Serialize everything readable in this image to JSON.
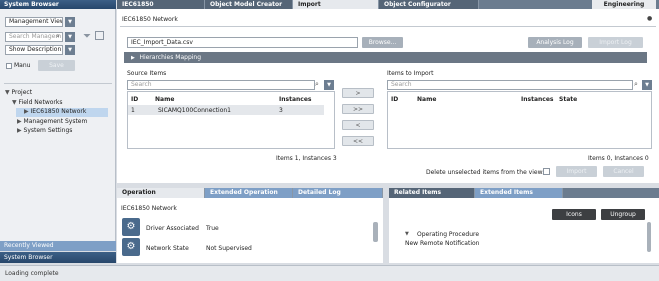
{
  "left_panel": {
    "title": "System Browser",
    "view_select": "Management View",
    "search_placeholder": "Search Managem",
    "description_select": "Show Description",
    "manual_label": "Manu",
    "save_label": "Save",
    "tree": [
      {
        "label": "Project"
      },
      {
        "label": "Field Networks"
      },
      {
        "label": "IEC61850 Network"
      },
      {
        "label": "Management System"
      },
      {
        "label": "System Settings"
      }
    ],
    "recently_viewed": "Recently Viewed",
    "footer_title": "System Browser"
  },
  "top_tabs": [
    {
      "label": "IEC61850"
    },
    {
      "label": "Object Model Creator"
    },
    {
      "label": "Import"
    },
    {
      "label": "Object Configurator"
    }
  ],
  "mode_label": "Engineering",
  "main": {
    "header": "IEC61850 Network",
    "file_value": "IEC_Import_Data.csv",
    "browse_label": "Browse...",
    "analysis_log_label": "Analysis Log",
    "import_log_label": "Import Log",
    "hierarchies_label": "Hierarchies Mapping",
    "source": {
      "title": "Source Items",
      "search_placeholder": "Search",
      "columns": [
        "ID",
        "Name",
        "Instances"
      ],
      "rows": [
        {
          "id": "1",
          "name": "SICAMQ100Connection1",
          "instances": "3"
        }
      ],
      "footer": "Items 1, Instances 3"
    },
    "transfer_buttons": [
      ">",
      ">>",
      "<",
      "<<"
    ],
    "target": {
      "title": "Items to Import",
      "search_placeholder": "Search",
      "columns": [
        "ID",
        "Name",
        "Instances",
        "State"
      ],
      "footer": "Items 0, Instances 0"
    },
    "delete_unselected_label": "Delete unselected items from the views:",
    "import_label": "Import",
    "cancel_label": "Cancel"
  },
  "bottom_left": {
    "tabs": [
      {
        "label": "Operation"
      },
      {
        "label": "Extended Operation"
      },
      {
        "label": "Detailed Log"
      }
    ],
    "title": "IEC61850 Network",
    "properties": [
      {
        "name": "Driver Associated",
        "value": "True"
      },
      {
        "name": "Network State",
        "value": "Not Supervised"
      }
    ]
  },
  "bottom_right": {
    "tabs": [
      {
        "label": "Related Items"
      },
      {
        "label": "Extended Items"
      }
    ],
    "icons_label": "Icons",
    "ungroup_label": "Ungroup",
    "group_title": "Operating Procedure",
    "group_item": "New Remote Notification"
  },
  "status": "Loading complete"
}
